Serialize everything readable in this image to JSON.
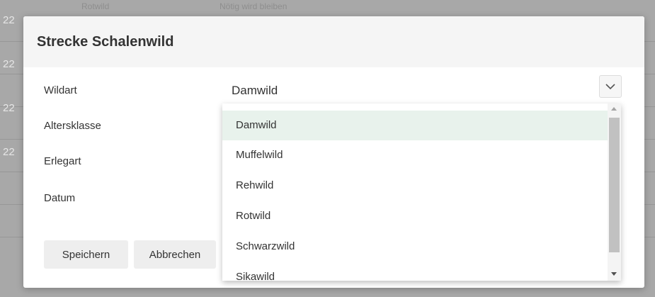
{
  "background": {
    "year_fragment": "22",
    "top_text_1": "Rotwild",
    "top_text_2": "Nötig wird bleiben"
  },
  "dialog": {
    "title": "Strecke Schalenwild",
    "fields": {
      "wildart_label": "Wildart",
      "altersklasse_label": "Altersklasse",
      "erlegart_label": "Erlegart",
      "datum_label": "Datum"
    },
    "wildart_value": "Damwild",
    "buttons": {
      "save": "Speichern",
      "cancel": "Abbrechen"
    }
  },
  "dropdown": {
    "options": [
      "Damwild",
      "Muffelwild",
      "Rehwild",
      "Rotwild",
      "Schwarzwild",
      "Sikawild"
    ],
    "selected": "Damwild"
  },
  "colors": {
    "selected_bg": "#e8f2ec",
    "overlay": "#a8a8a8"
  }
}
